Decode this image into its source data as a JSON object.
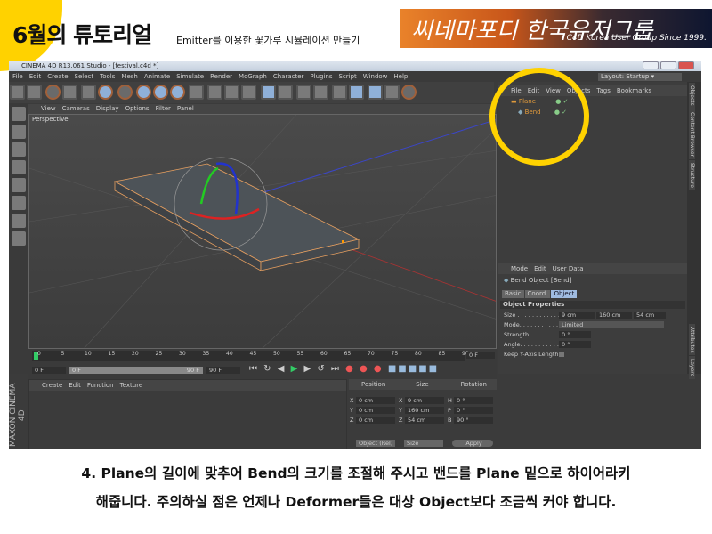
{
  "slide": {
    "title": "6월의 튜토리얼",
    "subtitle": "Emitter를 이용한 꽃가루 시뮬레이션 만들기",
    "banner": {
      "script": "씨네마포디 한국유저그룹",
      "tagline": "C4D Korea User Group Since 1999."
    },
    "caption": [
      "4. Plane의 길이에 맞추어 Bend의 크기를 조절해 주시고 밴드를 Plane 밑으로 하이어라키",
      "해줍니다. 주의하실 점은 언제나 Deformer들은 대상 Object보다 조금씩 커야 합니다."
    ],
    "accent": "#ffd200"
  },
  "app": {
    "title": "CINEMA 4D R13.061 Studio - [festival.c4d *]",
    "menu": [
      "File",
      "Edit",
      "Create",
      "Select",
      "Tools",
      "Mesh",
      "Animate",
      "Simulate",
      "Render",
      "MoGraph",
      "Character",
      "Plugins",
      "Script",
      "Window",
      "Help"
    ],
    "layout_label": "Layout:",
    "layout_value": "Startup",
    "viewport": {
      "menu": [
        "View",
        "Cameras",
        "Display",
        "Options",
        "Filter",
        "Panel"
      ],
      "label": "Perspective"
    },
    "objects": {
      "menu": [
        "File",
        "Edit",
        "View",
        "Objects",
        "Tags",
        "Bookmarks"
      ],
      "items": [
        {
          "name": "Plane"
        },
        {
          "name": "Bend"
        }
      ]
    },
    "side_tabs": [
      "Objects",
      "Content Browser",
      "Structure",
      "Attributes",
      "Layers"
    ],
    "attributes": {
      "menu": [
        "Mode",
        "Edit",
        "User Data"
      ],
      "object_title": "Bend Object [Bend]",
      "tabs": [
        "Basic",
        "Coord.",
        "Object"
      ],
      "section": "Object Properties",
      "size_label": "Size . . . . . . . . . . . .",
      "size": [
        "9 cm",
        "160 cm",
        "54 cm"
      ],
      "mode_label": "Mode. . . . . . . . . . . .",
      "mode": "Limited",
      "strength_label": "Strength . . . . . . . . .",
      "strength": "0 °",
      "angle_label": "Angle. . . . . . . . . . . .",
      "angle": "0 °",
      "keep_label": "Keep Y-Axis Length"
    },
    "timeline": {
      "ticks": [
        "0",
        "5",
        "10",
        "15",
        "20",
        "25",
        "30",
        "35",
        "40",
        "45",
        "50",
        "55",
        "60",
        "65",
        "70",
        "75",
        "80",
        "85",
        "90"
      ],
      "current": "0 F",
      "start": "0 F",
      "range_start": "0 F",
      "range_end": "90 F",
      "end": "90 F"
    },
    "material": {
      "menu": [
        "Create",
        "Edit",
        "Function",
        "Texture"
      ]
    },
    "coords": {
      "headers": [
        "Position",
        "Size",
        "Rotation"
      ],
      "rows": [
        [
          "X",
          "0 cm",
          "X",
          "9 cm",
          "H",
          "0 °"
        ],
        [
          "Y",
          "0 cm",
          "Y",
          "160 cm",
          "P",
          "0 °"
        ],
        [
          "Z",
          "0 cm",
          "Z",
          "54 cm",
          "B",
          "90 °"
        ]
      ],
      "mode": "Object (Rel)",
      "size_mode": "Size",
      "apply": "Apply"
    },
    "brand": "MAXON CINEMA 4D"
  }
}
